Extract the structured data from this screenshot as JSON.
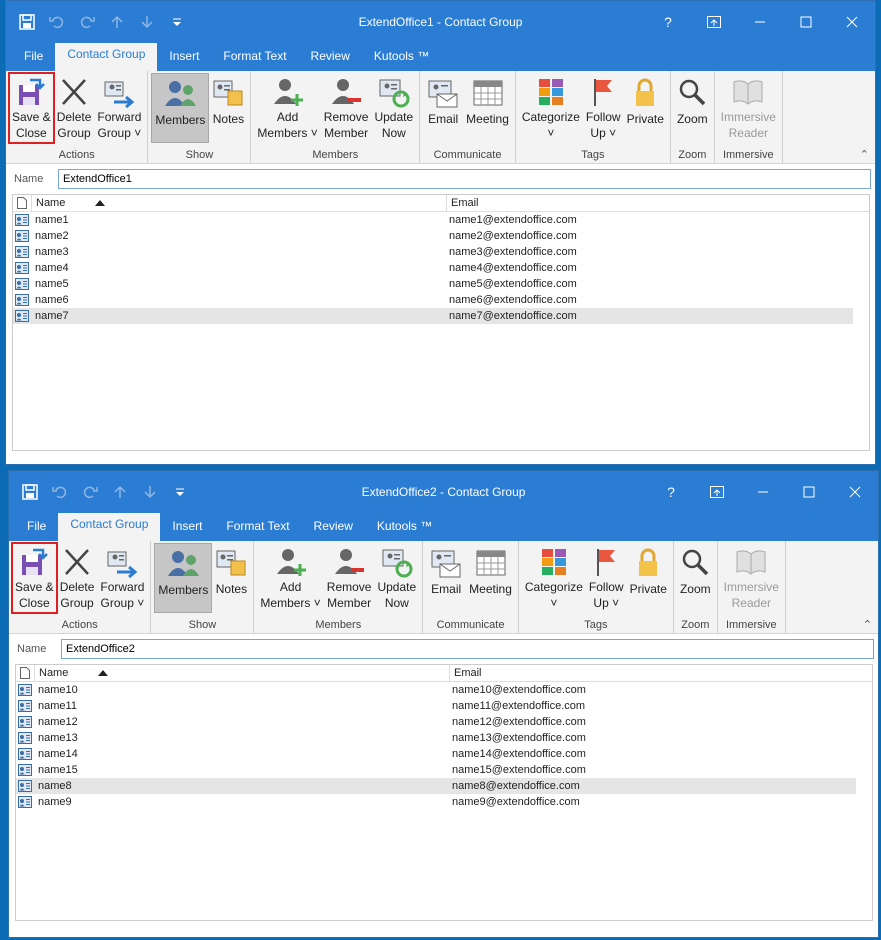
{
  "windows": [
    {
      "title": "ExtendOffice1  -  Contact Group",
      "tabs": [
        "File",
        "Contact Group",
        "Insert",
        "Format Text",
        "Review",
        "Kutools ™"
      ],
      "active_tab": "Contact Group",
      "name_label": "Name",
      "name_value": "ExtendOffice1",
      "columns": [
        "Name",
        "Email"
      ],
      "rows": [
        {
          "name": "name1",
          "email": "name1@extendoffice.com"
        },
        {
          "name": "name2",
          "email": "name2@extendoffice.com"
        },
        {
          "name": "name3",
          "email": "name3@extendoffice.com"
        },
        {
          "name": "name4",
          "email": "name4@extendoffice.com"
        },
        {
          "name": "name5",
          "email": "name5@extendoffice.com"
        },
        {
          "name": "name6",
          "email": "name6@extendoffice.com"
        },
        {
          "name": "name7",
          "email": "name7@extendoffice.com"
        }
      ],
      "selected_row": 6
    },
    {
      "title": "ExtendOffice2  -  Contact Group",
      "tabs": [
        "File",
        "Contact Group",
        "Insert",
        "Format Text",
        "Review",
        "Kutools ™"
      ],
      "active_tab": "Contact Group",
      "name_label": "Name",
      "name_value": "ExtendOffice2",
      "columns": [
        "Name",
        "Email"
      ],
      "rows": [
        {
          "name": "name10",
          "email": "name10@extendoffice.com"
        },
        {
          "name": "name11",
          "email": "name11@extendoffice.com"
        },
        {
          "name": "name12",
          "email": "name12@extendoffice.com"
        },
        {
          "name": "name13",
          "email": "name13@extendoffice.com"
        },
        {
          "name": "name14",
          "email": "name14@extendoffice.com"
        },
        {
          "name": "name15",
          "email": "name15@extendoffice.com"
        },
        {
          "name": "name8",
          "email": "name8@extendoffice.com"
        },
        {
          "name": "name9",
          "email": "name9@extendoffice.com"
        }
      ],
      "selected_row": 6
    }
  ],
  "ribbon": {
    "groups": [
      {
        "label": "Actions",
        "buttons": [
          {
            "id": "save-close",
            "l1": "Save &",
            "l2": "Close",
            "icon": "save-close-icon",
            "highlight": true
          },
          {
            "id": "delete-group",
            "l1": "Delete",
            "l2": "Group",
            "icon": "delete-x-icon"
          },
          {
            "id": "forward-group",
            "l1": "Forward",
            "l2": "Group ˅",
            "icon": "forward-group-icon"
          }
        ]
      },
      {
        "label": "Show",
        "buttons": [
          {
            "id": "members",
            "l1": "Members",
            "l2": "",
            "icon": "members-icon",
            "selected": true
          },
          {
            "id": "notes",
            "l1": "Notes",
            "l2": "",
            "icon": "notes-icon"
          }
        ]
      },
      {
        "label": "Members",
        "buttons": [
          {
            "id": "add-members",
            "l1": "Add",
            "l2": "Members ˅",
            "icon": "add-member-icon"
          },
          {
            "id": "remove-member",
            "l1": "Remove",
            "l2": "Member",
            "icon": "remove-member-icon"
          },
          {
            "id": "update-now",
            "l1": "Update",
            "l2": "Now",
            "icon": "update-now-icon"
          }
        ]
      },
      {
        "label": "Communicate",
        "buttons": [
          {
            "id": "email",
            "l1": "Email",
            "l2": "",
            "icon": "email-icon"
          },
          {
            "id": "meeting",
            "l1": "Meeting",
            "l2": "",
            "icon": "meeting-icon"
          }
        ]
      },
      {
        "label": "Tags",
        "buttons": [
          {
            "id": "categorize",
            "l1": "Categorize",
            "l2": "˅",
            "icon": "categorize-icon"
          },
          {
            "id": "follow-up",
            "l1": "Follow",
            "l2": "Up ˅",
            "icon": "flag-icon"
          },
          {
            "id": "private",
            "l1": "Private",
            "l2": "",
            "icon": "lock-icon"
          }
        ]
      },
      {
        "label": "Zoom",
        "buttons": [
          {
            "id": "zoom",
            "l1": "Zoom",
            "l2": "",
            "icon": "zoom-icon"
          }
        ]
      },
      {
        "label": "Immersive",
        "buttons": [
          {
            "id": "immersive-reader",
            "l1": "Immersive",
            "l2": "Reader",
            "icon": "immersive-reader-icon",
            "disabled": true
          }
        ]
      }
    ]
  },
  "colors": {
    "titlebar": "#2b7cd3",
    "highlight": "#e02020",
    "selected_button": "#c6c6c6"
  }
}
